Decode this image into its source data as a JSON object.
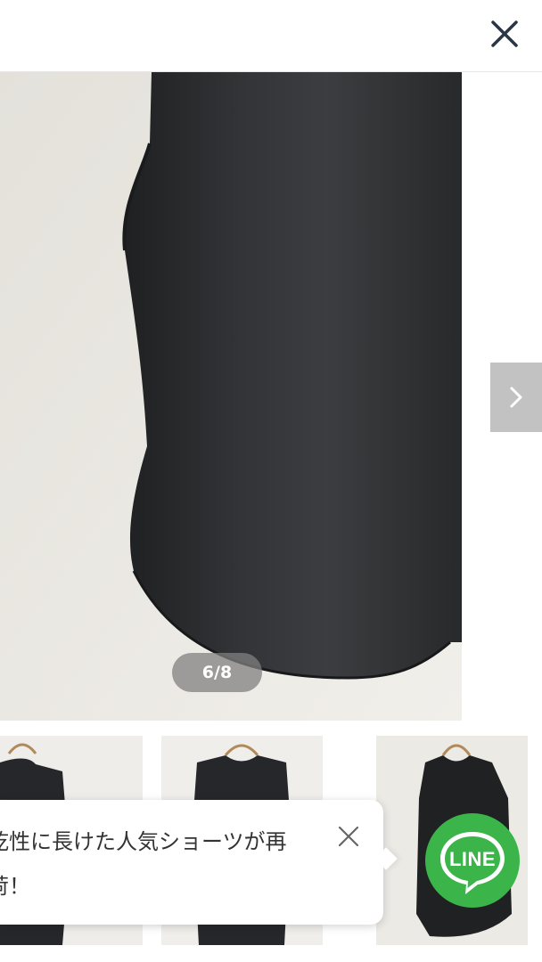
{
  "gallery": {
    "counter": "6/8",
    "close_icon": "close-icon",
    "next_icon": "chevron-right-icon"
  },
  "toast": {
    "lines": [
      "乾性に長けた人気ショーツが再",
      "荷！"
    ],
    "close_icon": "close-icon"
  },
  "line_button": {
    "label": "LINE",
    "color": "#3bb54a"
  },
  "colors": {
    "garment": "#2a2b2d",
    "wall": "#ecebe6",
    "overlay": "#808080"
  }
}
